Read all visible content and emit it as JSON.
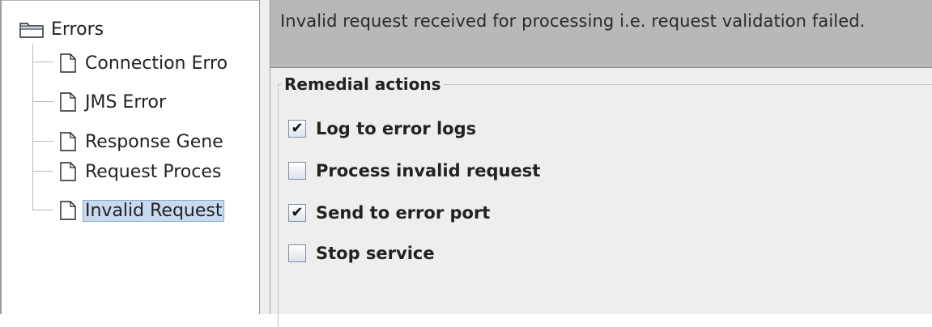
{
  "tree": {
    "root": {
      "label": "Errors",
      "icon": "folder-icon"
    },
    "items": [
      {
        "label": "Connection Erro",
        "icon": "document-icon",
        "selected": false
      },
      {
        "label": "JMS Error",
        "icon": "document-icon",
        "selected": false
      },
      {
        "label": "Response Gene",
        "icon": "document-icon",
        "selected": false
      },
      {
        "label": "Request Proces",
        "icon": "document-icon",
        "selected": false
      },
      {
        "label": "Invalid Request",
        "icon": "document-icon",
        "selected": true
      }
    ]
  },
  "detail": {
    "description": "Invalid request received for processing i.e. request validation failed.",
    "group_title": "Remedial actions",
    "options": [
      {
        "label": "Log to error logs",
        "checked": true
      },
      {
        "label": "Process invalid request",
        "checked": false
      },
      {
        "label": "Send to error port",
        "checked": true
      },
      {
        "label": "Stop service",
        "checked": false
      }
    ]
  },
  "colors": {
    "selection": "#c7daf0",
    "description_bg": "#b8b8b8",
    "panel_bg": "#eeeeee"
  }
}
